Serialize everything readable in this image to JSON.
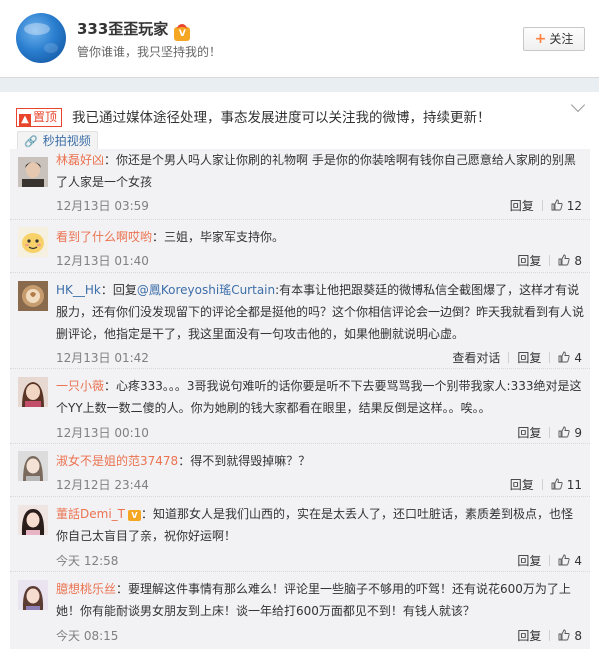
{
  "profile": {
    "name": "333歪歪玩家",
    "bio": "管你谁谁，我只坚持我的！",
    "vip_badge": "V",
    "follow_label": "关注"
  },
  "post": {
    "pin_label": "置顶",
    "text": "我已通过媒体途径处理，事态发展进度可以关注我的微博，持续更新！",
    "video_label": "秒拍视频"
  },
  "icons": {
    "avatar_main": "avatar-icon",
    "follow_plus": "plus-icon",
    "chevron": "chevron-down-icon",
    "pin": "pin-icon",
    "link": "link-icon",
    "like": "thumbs-up-icon"
  },
  "comments": [
    {
      "user": "林磊好凶",
      "text": "：你还是个男人吗人家让你刷的礼物啊 手是你的你装啥啊有钱你自己愿意给人家刷的别黑了人家是一个女孩",
      "time": "12月13日 03:59",
      "reply": "回复",
      "likes": "12"
    },
    {
      "user": "看到了什么啊哎哟",
      "text": "：三姐，毕家军支持你。",
      "time": "12月13日 01:40",
      "reply": "回复",
      "likes": "8"
    },
    {
      "user": "HK__Hk",
      "text_pre": "：回复",
      "mention": "@鳳Koreyoshi瑤Curtain",
      "text": ":有本事让他把跟葵廷的微博私信全截图爆了，这样才有说服力，还有你们没发现留下的评论全都是挺他的吗？这个你相信评论会一边倒？昨天我就看到有人说删评论，他指定是干了，我这里面没有一句攻击他的，如果他删就说明心虚。",
      "time": "12月13日 01:42",
      "view_conversation": "查看对话",
      "reply": "回复",
      "likes": "4"
    },
    {
      "user": "一只小薇",
      "text": "：心疼333。。。3哥我说句难听的话你要是听不下去要骂骂我一个别带我家人:333绝对是这个YY上数一数二傻的人。你为她刷的钱大家都看在眼里，结果反倒是这样。。唉。。",
      "time": "12月13日 00:10",
      "reply": "回复",
      "likes": "9"
    },
    {
      "user": "淑女不是姐的范37478",
      "text": "：得不到就得毁掉嘛？？",
      "time": "12月12日 23:44",
      "reply": "回复",
      "likes": "11"
    },
    {
      "user": "董話Demi_T",
      "text": "：知道那女人是我们山西的，实在是太丢人了，还口吐脏话，素质差到极点，也怪你自己太盲目了亲，祝你好运啊！",
      "time": "今天 12:58",
      "reply": "回复",
      "likes": "4"
    },
    {
      "user": "臆想桃乐丝",
      "text": "：要理解这件事情有那么难么！评论里一些脑子不够用的吓驾！还有说花600万为了上她！你有能耐谈男女朋友到上床！谈一年给打600万面都见不到！有钱人就该？",
      "time": "今天 08:15",
      "reply": "回复",
      "likes": "8"
    }
  ]
}
